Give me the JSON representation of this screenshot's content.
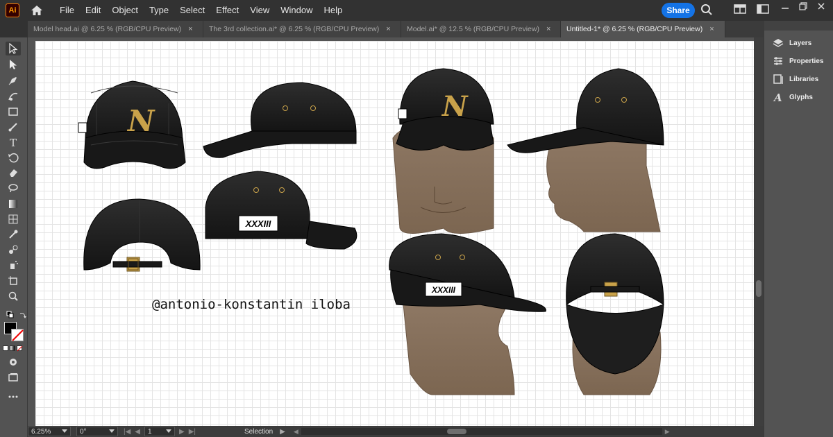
{
  "app": {
    "logo": "Ai"
  },
  "menu": [
    "File",
    "Edit",
    "Object",
    "Type",
    "Select",
    "Effect",
    "View",
    "Window",
    "Help"
  ],
  "share_label": "Share",
  "tabs": [
    {
      "label": "Model head.ai @ 6.25 % (RGB/CPU Preview)",
      "close": "×"
    },
    {
      "label": "The 3rd collection.ai* @ 6.25 % (RGB/CPU Preview)",
      "close": "×"
    },
    {
      "label": "Model.ai* @ 12.5 % (RGB/CPU Preview)",
      "close": "×"
    },
    {
      "label": "Untitled-1* @ 6.25 % (RGB/CPU Preview)",
      "close": "×"
    }
  ],
  "panel": {
    "items": [
      {
        "label": "Layers",
        "icon": "layers-icon"
      },
      {
        "label": "Properties",
        "icon": "properties-icon"
      },
      {
        "label": "Libraries",
        "icon": "libraries-icon"
      },
      {
        "label": "Glyphs",
        "icon": "glyphs-icon"
      }
    ]
  },
  "artwork": {
    "monogram": "N",
    "label_text": "XXXIII",
    "watermark": "@antonio-konstantin iloba"
  },
  "status": {
    "zoom": "6.25%",
    "rotation": "0°",
    "artboard_num": "1",
    "tool": "Selection"
  },
  "colors": {
    "accent": "#1473e6",
    "cap": "#1c1c1c",
    "skin": "#8a735f",
    "gold": "#c9a24a"
  }
}
